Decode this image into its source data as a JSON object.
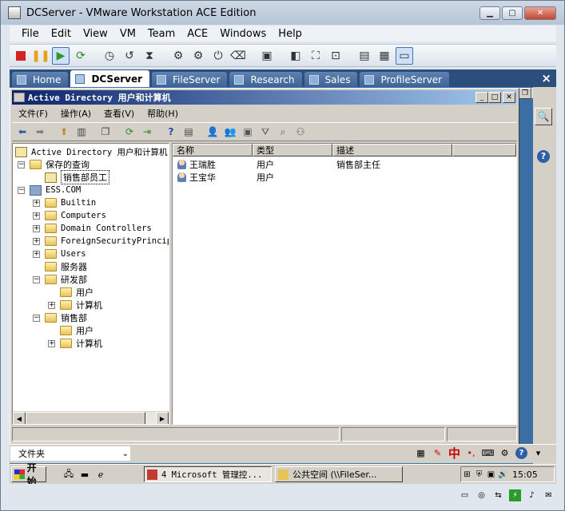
{
  "vm": {
    "title": "DCServer - VMware Workstation ACE Edition",
    "menu": [
      "File",
      "Edit",
      "View",
      "VM",
      "Team",
      "ACE",
      "Windows",
      "Help"
    ],
    "tabs": [
      {
        "label": "Home"
      },
      {
        "label": "DCServer",
        "active": true
      },
      {
        "label": "FileServer"
      },
      {
        "label": "Research"
      },
      {
        "label": "Sales"
      },
      {
        "label": "ProfileServer"
      }
    ],
    "tab_close": "×"
  },
  "ad": {
    "title": "Active Directory 用户和计算机",
    "menu": [
      "文件(F)",
      "操作(A)",
      "查看(V)",
      "帮助(H)"
    ],
    "tree": {
      "root": "Active Directory 用户和计算机",
      "saved_queries": "保存的查询",
      "sales_staff_query": "销售部员工",
      "domain": "ESS.COM",
      "builtin": "Builtin",
      "computers": "Computers",
      "domain_controllers": "Domain Controllers",
      "foreign": "ForeignSecurityPrincip",
      "users": "Users",
      "servers": "服务器",
      "rd": "研发部",
      "rd_users": "用户",
      "rd_computers": "计算机",
      "sales": "销售部",
      "sales_users": "用户",
      "sales_computers": "计算机"
    },
    "columns": {
      "name": "名称",
      "type": "类型",
      "desc": "描述"
    },
    "rows": [
      {
        "name": "王瑞胜",
        "type": "用户",
        "desc": "销售部主任"
      },
      {
        "name": "王宝华",
        "type": "用户",
        "desc": ""
      }
    ]
  },
  "guest": {
    "ime_label": "文件夹",
    "ime_zh": "中",
    "start": "开始",
    "tasks": [
      {
        "label": "4 Microsoft 管理控..."
      },
      {
        "label": "公共空间 (\\\\FileSer..."
      }
    ],
    "clock": "15:05"
  },
  "colors": {
    "ad_title_start": "#0a246a",
    "ad_title_end": "#a6caf0",
    "vm_tab_bar": "#2b4e7d",
    "guest_desktop": "#3a6ea5"
  }
}
